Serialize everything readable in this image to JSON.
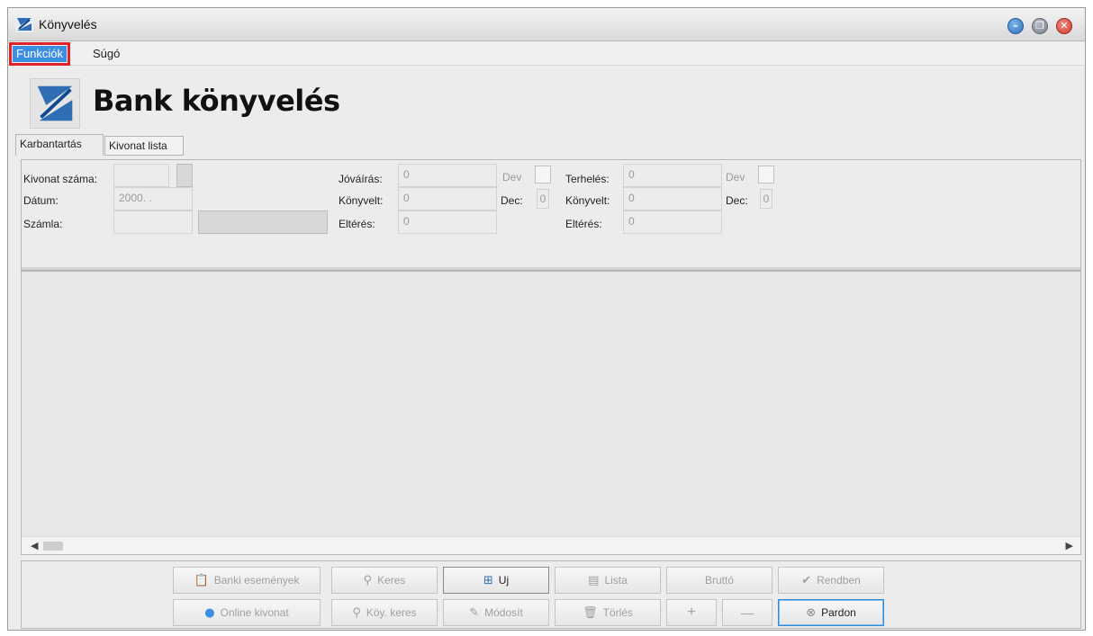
{
  "window": {
    "title": "Könyvelés"
  },
  "menu": {
    "functions": "Funkciók",
    "help": "Súgó"
  },
  "header": {
    "title": "Bank könyvelés"
  },
  "tabs": [
    {
      "label": "Karbantartás"
    },
    {
      "label": "Kivonat lista"
    }
  ],
  "form": {
    "kivonat_szama_label": "Kivonat száma:",
    "datum_label": "Dátum:",
    "datum_value": "2000.  .",
    "szamla_label": "Számla:",
    "jovairas_label": "Jóváírás:",
    "jovairas_value": "0",
    "jovairas_dev_label": "Dev",
    "konyvelt1_label": "Könyvelt:",
    "konyvelt1_value": "0",
    "dec1_label": "Dec:",
    "dec1_value": "0",
    "elteres1_label": "Eltérés:",
    "elteres1_value": "0",
    "terheles_label": "Terhelés:",
    "terheles_value": "0",
    "terheles_dev_label": "Dev",
    "konyvelt2_label": "Könyvelt:",
    "konyvelt2_value": "0",
    "dec2_label": "Dec:",
    "dec2_value": "0",
    "elteres2_label": "Eltérés:",
    "elteres2_value": "0"
  },
  "buttons": {
    "banki_esemenyek": "Banki események",
    "online_kivonat": "Online kivonat",
    "keres": "Keres",
    "koy_keres": "Köy. keres",
    "uj": "Uj",
    "modosit": "Módosít",
    "lista": "Lista",
    "torles": "Törlés",
    "brutto": "Bruttó",
    "plus": "+",
    "minus": "—",
    "rendben": "Rendben",
    "pardon": "Pardon"
  },
  "colors": {
    "accent": "#3c8ee0",
    "highlight": "#e2222b"
  }
}
